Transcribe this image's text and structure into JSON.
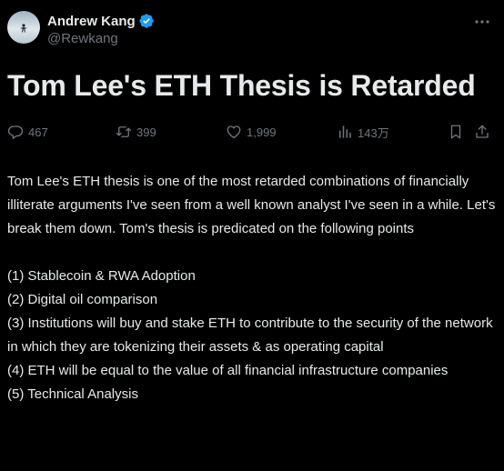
{
  "author": {
    "name": "Andrew Kang",
    "handle": "@Rewkang",
    "verified_color": "#1d9bf0"
  },
  "post": {
    "title": "Tom Lee's ETH Thesis is Retarded",
    "body_intro": "Tom Lee's ETH thesis is one of the most retarded combinations of financially illiterate arguments I've seen from a well known analyst I've seen in a while. Let's break them down. Tom's thesis is predicated on the following points",
    "points": [
      "(1) Stablecoin & RWA Adoption",
      "(2) Digital oil comparison",
      "(3) Institutions will buy and stake ETH to contribute to the security of the network in which they are tokenizing their assets & as operating capital",
      "(4) ETH will be equal to the value of all financial infrastructure companies",
      "(5) Technical Analysis"
    ]
  },
  "stats": {
    "replies": "467",
    "reposts": "399",
    "likes": "1,999",
    "views": "143万"
  },
  "icons": {
    "reply": "reply-icon",
    "repost": "repost-icon",
    "like": "like-icon",
    "views": "views-icon",
    "bookmark": "bookmark-icon",
    "share": "share-icon",
    "more": "more-icon",
    "verified": "verified-badge-icon"
  },
  "colors": {
    "background": "#000000",
    "text": "#e7e9ea",
    "muted": "#71767b",
    "accent": "#1d9bf0"
  }
}
